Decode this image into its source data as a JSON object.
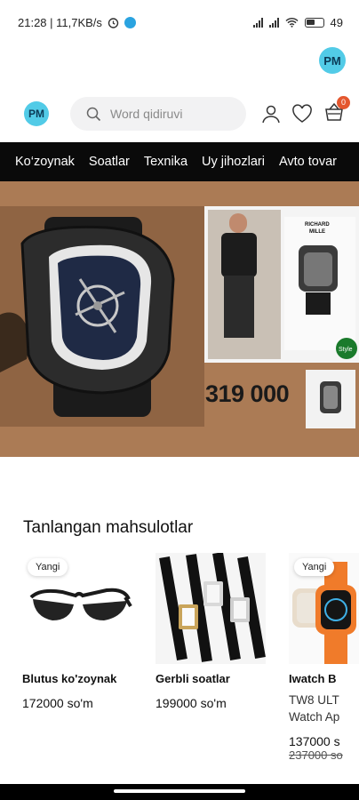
{
  "status_bar": {
    "time_speed": "21:28 | 11,7KB/s",
    "battery": "49"
  },
  "logo": {
    "text": "PM"
  },
  "search": {
    "placeholder": "Word qidiruvi"
  },
  "cart": {
    "count": "0"
  },
  "nav": {
    "items": [
      {
        "label": "Ko‘zoynak"
      },
      {
        "label": "Soatlar"
      },
      {
        "label": "Texnika"
      },
      {
        "label": "Uy jihozlari"
      },
      {
        "label": "Avto tovar"
      }
    ]
  },
  "banner": {
    "price": "319 000",
    "brand_line1": "RICHARD",
    "brand_line2": "MILLE",
    "style_badge": "Style"
  },
  "section": {
    "title": "Tanlangan mahsulotlar"
  },
  "products": [
    {
      "tag": "Yangi",
      "name": "Blutus ko'zoynak",
      "price": "172000 so'm"
    },
    {
      "name": "Gerbli soatlar",
      "price": "199000 so'm"
    },
    {
      "tag": "Yangi",
      "name": "Iwatch B",
      "desc1": "TW8 ULT",
      "desc2": "Watch Ap",
      "price": "137000 s",
      "old_price": "237000 so"
    }
  ],
  "colors": {
    "accent": "#52cbe7",
    "nav_bg": "#0a0a0a",
    "banner_bg": "#ab7b55",
    "badge": "#e4572e"
  }
}
